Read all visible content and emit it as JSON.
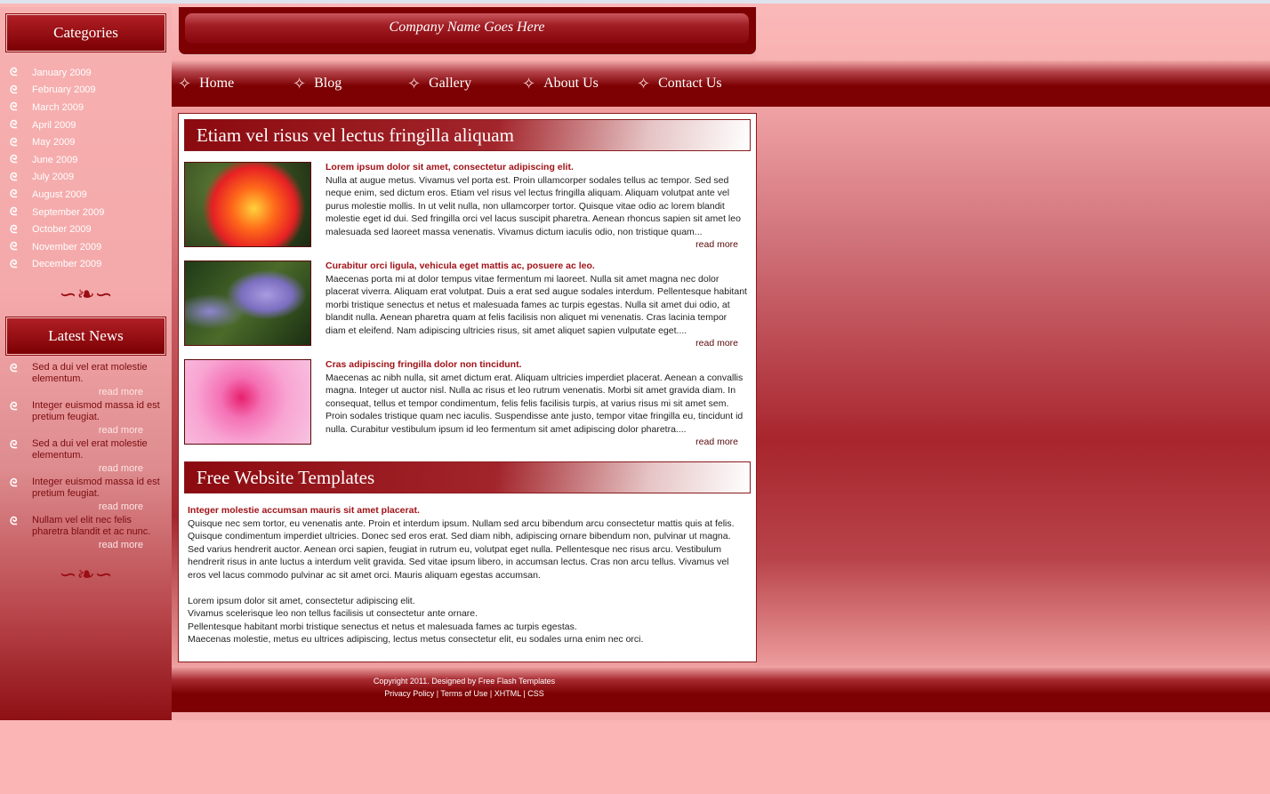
{
  "header": {
    "company": "Company Name Goes Here"
  },
  "nav": [
    "Home",
    "Blog",
    "Gallery",
    "About Us",
    "Contact Us"
  ],
  "sidebar": {
    "categories_title": "Categories",
    "categories": [
      "January 2009",
      "February 2009",
      "March 2009",
      "April 2009",
      "May 2009",
      "June 2009",
      "July 2009",
      "August 2009",
      "September 2009",
      "October 2009",
      "November 2009",
      "December 2009"
    ],
    "news_title": "Latest News",
    "news": [
      {
        "text": "Sed a dui vel erat molestie elementum.",
        "more": "read more"
      },
      {
        "text": "Integer euismod massa id est pretium feugiat.",
        "more": "read more"
      },
      {
        "text": "Sed a dui vel erat molestie elementum.",
        "more": "read more"
      },
      {
        "text": "Integer euismod massa id est pretium feugiat.",
        "more": "read more"
      },
      {
        "text": "Nullam vel elit nec felis pharetra blandit et ac nunc.",
        "more": "read more"
      }
    ]
  },
  "main": {
    "title1": "Etiam vel risus vel lectus fringilla aliquam",
    "posts": [
      {
        "heading": "Lorem ipsum dolor sit amet, consectetur adipiscing elit.",
        "body": "Nulla at augue metus. Vivamus vel porta est. Proin ullamcorper sodales tellus ac tempor. Sed sed neque enim, sed dictum eros. Etiam vel risus vel lectus fringilla aliquam. Aliquam volutpat ante vel purus molestie mollis. In ut velit nulla, non ullamcorper tortor. Quisque vitae odio ac lorem blandit molestie eget id dui. Sed fringilla orci vel lacus suscipit pharetra. Aenean rhoncus sapien sit amet leo malesuada sed laoreet massa venenatis. Vivamus dictum iaculis odio, non tristique quam...",
        "more": "read more"
      },
      {
        "heading": "Curabitur orci ligula, vehicula eget mattis ac, posuere ac leo.",
        "body": "Maecenas porta mi at dolor tempus vitae fermentum mi laoreet. Nulla sit amet magna nec dolor placerat viverra. Aliquam erat volutpat. Duis a erat sed augue sodales interdum. Pellentesque habitant morbi tristique senectus et netus et malesuada fames ac turpis egestas. Nulla sit amet dui odio, at blandit nulla. Aenean pharetra quam at felis facilisis non aliquet mi venenatis. Cras lacinia tempor diam et eleifend. Nam adipiscing ultricies risus, sit amet aliquet sapien vulputate eget....",
        "more": "read more"
      },
      {
        "heading": "Cras adipiscing fringilla dolor non tincidunt.",
        "body": "Maecenas ac nibh nulla, sit amet dictum erat. Aliquam ultricies imperdiet placerat. Aenean a convallis magna. Integer ut auctor nisl. Nulla ac risus et leo rutrum venenatis. Morbi sit amet gravida diam. In consequat, tellus et tempor condimentum, felis felis facilisis turpis, at varius risus mi sit amet sem. Proin sodales tristique quam nec iaculis. Suspendisse ante justo, tempor vitae fringilla eu, tincidunt id nulla. Curabitur vestibulum ipsum id leo fermentum sit amet adipiscing dolor pharetra....",
        "more": "read more"
      }
    ],
    "title2": "Free Website Templates",
    "section_heading": "Integer molestie accumsan mauris sit amet placerat.",
    "section_para": "Quisque nec sem tortor, eu venenatis ante. Proin et interdum ipsum. Nullam sed arcu bibendum arcu consectetur mattis quis at felis. Quisque condimentum imperdiet ultricies. Donec sed eros erat. Sed diam nibh, adipiscing ornare bibendum non, pulvinar ut magna. Sed varius hendrerit auctor. Aenean orci sapien, feugiat in rutrum eu, volutpat eget nulla. Pellentesque nec risus arcu. Vestibulum hendrerit risus in ante luctus a interdum velit gravida. Sed vitae ipsum libero, in accumsan lectus. Cras non arcu tellus. Vivamus vel eros vel lacus commodo pulvinar ac sit amet orci. Mauris aliquam egestas accumsan.",
    "lines": [
      "Lorem ipsum dolor sit amet, consectetur adipiscing elit.",
      "Vivamus scelerisque leo non tellus facilisis ut consectetur ante ornare.",
      "Pellentesque habitant morbi tristique senectus et netus et malesuada fames ac turpis egestas.",
      "Maecenas molestie, metus eu ultrices adipiscing, lectus metus consectetur elit, eu sodales urna enim nec orci."
    ]
  },
  "footer": {
    "copyright": "Copyright 2011. Designed by Free Flash Templates",
    "links": [
      "Privacy Policy",
      "Terms of Use",
      "XHTML",
      "CSS"
    ]
  },
  "colors": {
    "brand": "#7d0002",
    "heading": "#a11318",
    "background": "#fbb5b5"
  }
}
